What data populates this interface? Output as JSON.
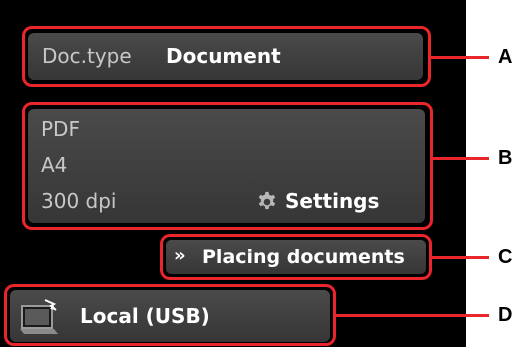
{
  "doc_type": {
    "label": "Doc.type",
    "value": "Document"
  },
  "scan_settings": {
    "format": "PDF",
    "paper_size": "A4",
    "resolution": "300 dpi",
    "settings_label": "Settings"
  },
  "placing_documents": {
    "label": "Placing documents"
  },
  "destination": {
    "label": "Local (USB)"
  },
  "callouts": {
    "a": "A",
    "b": "B",
    "c": "C",
    "d": "D"
  },
  "colors": {
    "highlight": "#e8262b",
    "screen_background": "#000000",
    "panel": "#404040"
  },
  "icons": {
    "settings": "gear-icon",
    "placing": "double-chevron-right-icon",
    "destination": "computer-icon"
  }
}
